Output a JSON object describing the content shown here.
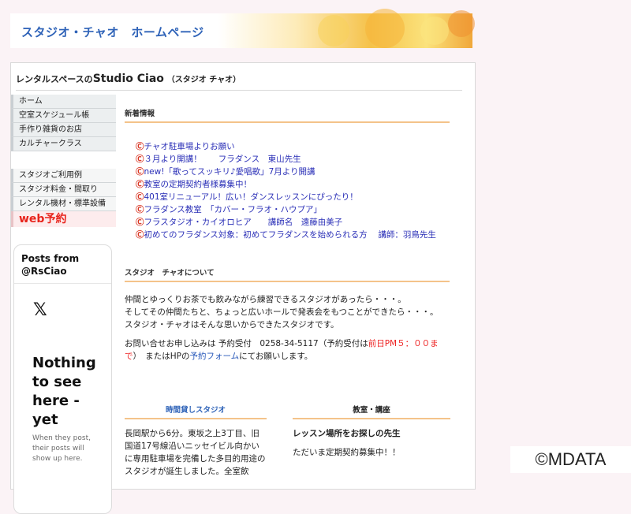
{
  "header": {
    "title": "スタジオ・チャオ　ホームページ"
  },
  "site_title": {
    "prefix": "レンタルスペースの",
    "name": "Studio Ciao",
    "suffix": "（スタジオ チャオ）"
  },
  "sidebar": {
    "group1": [
      "ホーム",
      "空室スケジュール帳",
      "手作り雑貨のお店",
      "カルチャークラス"
    ],
    "group2": [
      "スタジオご利用例",
      "スタジオ料金・間取り",
      "レンタル機材・標準設備"
    ],
    "web_reserve": "web予約"
  },
  "twitter": {
    "title": "Posts from @RsCiao",
    "x_logo": "𝕏",
    "message": "Nothing to see here - yet",
    "sub": "When they post, their posts will show up here."
  },
  "news": {
    "heading": "新着情報",
    "mark": "Ⓒ",
    "items": [
      "チャオ駐車場よりお願い",
      "３月より開講！　　フラダンス　東山先生",
      "new!「歌ってスッキリ♪愛唱歌」7月より開講",
      "教室の定期契約者様募集中！",
      "401室リニューアル！広い！ダンスレッスンにぴったり！",
      "フラダンス教室　「カバー・フラオ・ハウプア」",
      "フラスタジオ・カイオロヒア　　講師名　遠藤由美子",
      "初めてのフラダンス対象：初めてフラダンスを始められる方　 講師：羽鳥先生"
    ]
  },
  "about": {
    "heading": "スタジオ　チャオについて",
    "lines": [
      "仲間とゆっくりお茶でも飲みながら練習できるスタジオがあったら・・・。",
      "そしてその仲間たちと、ちょっと広いホールで発表会をもつことができたら・・・。",
      "スタジオ・チャオはそんな思いからできたスタジオです。"
    ],
    "contact_pre": "お問い合せお申し込みは 予約受付　0258-34-5117（予約受付は",
    "contact_red": "前日PM５：００まで",
    "contact_mid": "）　またはHPの",
    "contact_link": "予約フォーム",
    "contact_post": "にてお願いします。"
  },
  "bottom_left": {
    "heading": "時間貸しスタジオ",
    "text": "長岡駅から6分。東坂之上3丁目、旧国道17号線沿いニッセイビル向かいに専用駐車場を完備した多目的用途のスタジオが誕生しました。全室飲"
  },
  "bottom_right": {
    "heading": "教室・講座",
    "sub": "レッスン場所をお探しの先生",
    "text": "ただいま定期契約募集中！！"
  },
  "watermark": "©MDATA"
}
